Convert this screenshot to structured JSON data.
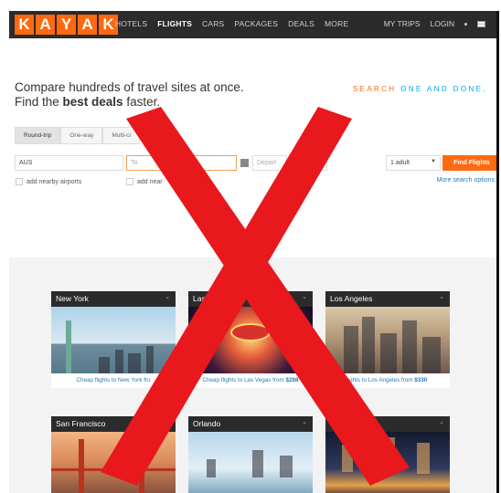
{
  "header": {
    "logo_letters": [
      "K",
      "A",
      "Y",
      "A",
      "K"
    ],
    "nav": [
      "HOTELS",
      "FLIGHTS",
      "CARS",
      "PACKAGES",
      "DEALS",
      "MORE"
    ],
    "active_nav": "FLIGHTS",
    "right_nav": [
      "MY TRIPS",
      "LOGIN"
    ]
  },
  "hero": {
    "line1": "Compare hundreds of travel sites at once.",
    "line2_prefix": "Find the ",
    "line2_bold": "best deals",
    "line2_suffix": " faster.",
    "tagline_part1": "SEARCH ",
    "tagline_part2": "ONE AND DONE."
  },
  "trip_tabs": [
    "Round-trip",
    "One-way",
    "Multi-ci"
  ],
  "search": {
    "origin": "AUS",
    "destination_placeholder": "To",
    "depart_placeholder": "Depart",
    "return_placeholder": "Retu",
    "travelers": "1 adult",
    "find_label": "Find Flights"
  },
  "options": {
    "nearby_origin": "add nearby airports",
    "nearby_dest": "add near",
    "more": "More search options"
  },
  "destinations": [
    {
      "city": "New York",
      "caption": "Cheap flights to New York fro",
      "price": ""
    },
    {
      "city": "Las",
      "caption": "Cheap flights to Las Vegas from ",
      "price": "$288"
    },
    {
      "city": "Los Angeles",
      "caption": "ights to Los Angeles from ",
      "price": "$330"
    },
    {
      "city": "San Francisco",
      "caption": "",
      "price": ""
    },
    {
      "city": "Orlando",
      "caption": "",
      "price": ""
    },
    {
      "city": "C",
      "caption": "",
      "price": ""
    }
  ],
  "overlay": {
    "symbol": "x-mark",
    "color": "#e8181c"
  },
  "colors": {
    "brand_orange": "#ff690f",
    "topbar": "#2b2b2b",
    "accent_blue": "#00a7e1",
    "link_blue": "#2a7ab8"
  }
}
